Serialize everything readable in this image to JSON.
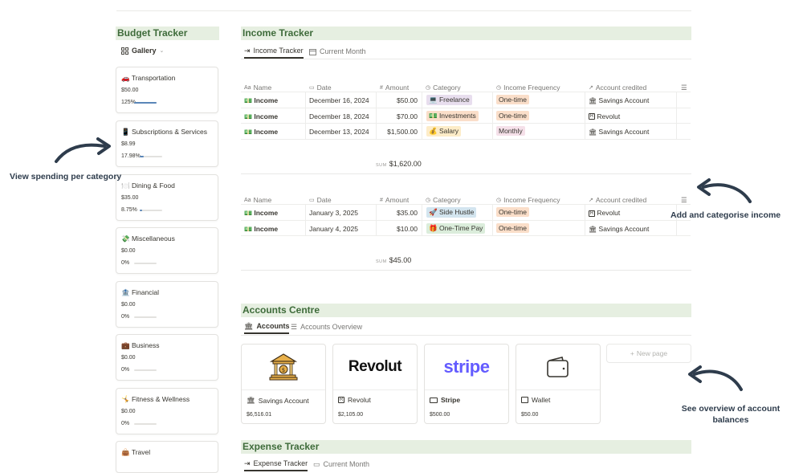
{
  "budget": {
    "title": "Budget Tracker",
    "view_label": "Gallery",
    "cards": [
      {
        "icon": "🚗",
        "name": "Transportation",
        "amount": "$50.00",
        "pct": "125%",
        "fill": 1.0
      },
      {
        "icon": "📱",
        "name": "Subscriptions & Services",
        "amount": "$8.99",
        "pct": "17.98%",
        "fill": 0.18
      },
      {
        "icon": "🍽️",
        "name": "Dining & Food",
        "amount": "$35.00",
        "pct": "8.75%",
        "fill": 0.09
      },
      {
        "icon": "💸",
        "name": "Miscellaneous",
        "amount": "$0.00",
        "pct": "0%",
        "fill": 0
      },
      {
        "icon": "🏦",
        "name": "Financial",
        "amount": "$0.00",
        "pct": "0%",
        "fill": 0
      },
      {
        "icon": "💼",
        "name": "Business",
        "amount": "$0.00",
        "pct": "0%",
        "fill": 0
      },
      {
        "icon": "🤸",
        "name": "Fitness & Wellness",
        "amount": "$0.00",
        "pct": "0%",
        "fill": 0
      },
      {
        "icon": "👜",
        "name": "Travel",
        "amount": "",
        "pct": "",
        "fill": 0
      }
    ]
  },
  "income": {
    "title": "Income Tracker",
    "tabs": [
      "Income Tracker",
      "Current Month"
    ],
    "columns": [
      "Name",
      "Date",
      "Amount",
      "Category",
      "Income Frequency",
      "Account credited"
    ],
    "group1": {
      "rows": [
        {
          "name": "Income",
          "date": "December 16, 2024",
          "amount": "$50.00",
          "category": "💻 Freelance",
          "cat_color": "#e8deee",
          "freq": "One-time",
          "freq_color": "#fadec9",
          "account": "Savings Account",
          "acc_icon": "bank"
        },
        {
          "name": "Income",
          "date": "December 18, 2024",
          "amount": "$70.00",
          "category": "💵 Investments",
          "cat_color": "#fadec9",
          "freq": "One-time",
          "freq_color": "#fadec9",
          "account": "Revolut",
          "acc_icon": "revolut"
        },
        {
          "name": "Income",
          "date": "December 13, 2024",
          "amount": "$1,500.00",
          "category": "💰 Salary",
          "cat_color": "#fdecc8",
          "freq": "Monthly",
          "freq_color": "#f5e0e9",
          "account": "Savings Account",
          "acc_icon": "bank"
        }
      ],
      "sum_label": "SUM",
      "sum": "$1,620.00"
    },
    "group2": {
      "rows": [
        {
          "name": "Income",
          "date": "January 3, 2025",
          "amount": "$35.00",
          "category": "🚀 Side Hustle",
          "cat_color": "#d3e5ef",
          "freq": "One-time",
          "freq_color": "#fadec9",
          "account": "Revolut",
          "acc_icon": "revolut"
        },
        {
          "name": "Income",
          "date": "January 4, 2025",
          "amount": "$10.00",
          "category": "🎁 One-Time Pay",
          "cat_color": "#dbeddb",
          "freq": "One-time",
          "freq_color": "#fadec9",
          "account": "Savings Account",
          "acc_icon": "bank"
        }
      ],
      "sum_label": "SUM",
      "sum": "$45.00"
    }
  },
  "accounts": {
    "title": "Accounts Centre",
    "tabs": [
      "Accounts",
      "Accounts Overview"
    ],
    "cards": [
      {
        "name": "Savings Account",
        "balance": "$6,516.01",
        "logo": "bank"
      },
      {
        "name": "Revolut",
        "balance": "$2,105.00",
        "logo": "Revolut"
      },
      {
        "name": "Stripe",
        "balance": "$500.00",
        "logo": "stripe"
      },
      {
        "name": "Wallet",
        "balance": "$50.00",
        "logo": "wallet"
      }
    ],
    "new_page": "New page"
  },
  "expense": {
    "title": "Expense Tracker",
    "tabs": [
      "Expense Tracker",
      "Current Month"
    ]
  },
  "notes": {
    "left": "View spending per category",
    "right_top": "Add and categorise income",
    "right_bottom_1": "See overview of account",
    "right_bottom_2": "balances"
  },
  "colors": {
    "accent": "#3e6b3a",
    "header_bg": "#e6efe1",
    "note": "#2e3c4c"
  }
}
